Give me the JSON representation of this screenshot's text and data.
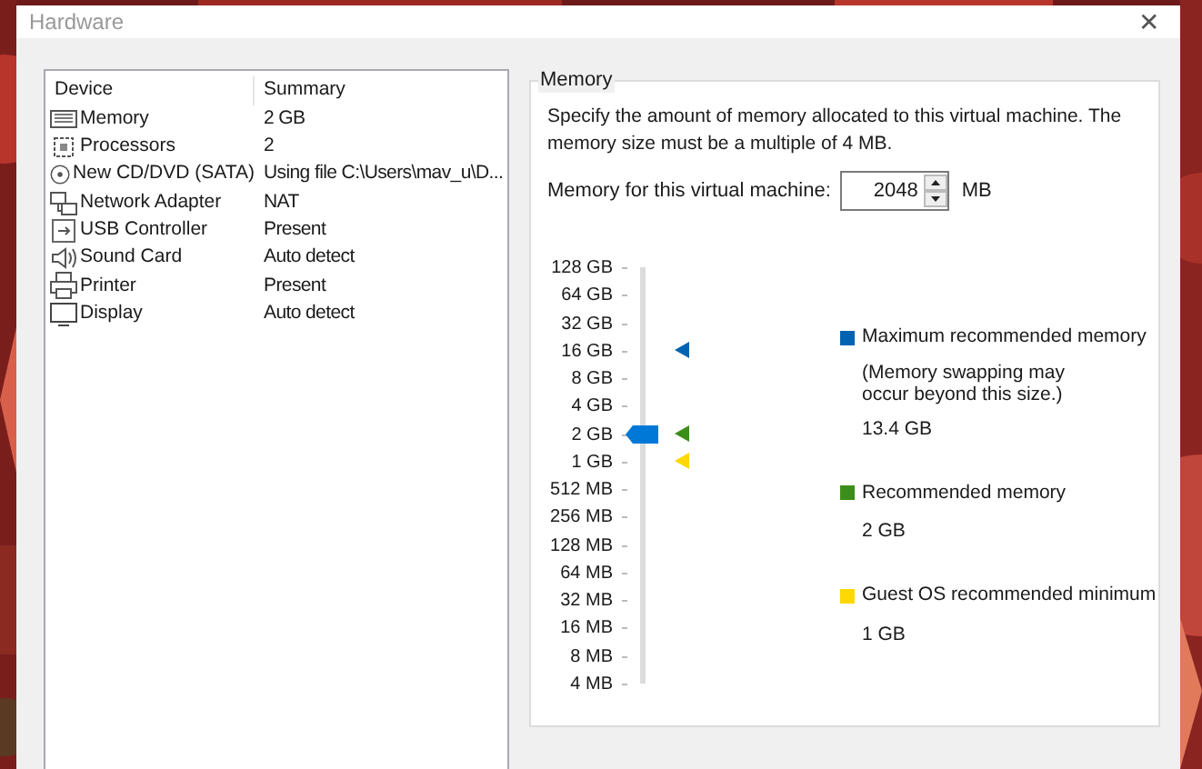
{
  "window": {
    "title": "Hardware",
    "close": "✕"
  },
  "device_list": {
    "columns": [
      "Device",
      "Summary"
    ],
    "rows": [
      {
        "kind": "memory",
        "device": "Memory",
        "summary": "2 GB",
        "selected": false
      },
      {
        "kind": "processor",
        "device": "Processors",
        "summary": "2",
        "selected": false
      },
      {
        "kind": "disc",
        "device": "New CD/DVD (SATA)",
        "summary": "Using file C:\\Users\\mav_u\\D...",
        "selected": false
      },
      {
        "kind": "network",
        "device": "Network Adapter",
        "summary": "NAT",
        "selected": false
      },
      {
        "kind": "usb",
        "device": "USB Controller",
        "summary": "Present",
        "selected": false
      },
      {
        "kind": "sound",
        "device": "Sound Card",
        "summary": "Auto detect",
        "selected": false
      },
      {
        "kind": "printer",
        "device": "Printer",
        "summary": "Present",
        "selected": false
      },
      {
        "kind": "display",
        "device": "Display",
        "summary": "Auto detect",
        "selected": false
      }
    ]
  },
  "memory": {
    "title": "Memory",
    "description": "Specify the amount of memory allocated to this virtual machine. The memory size must be a multiple of 4 MB.",
    "field_label": "Memory for this virtual machine:",
    "value": "2048",
    "unit": "MB",
    "scale": [
      "128 GB",
      "64 GB",
      "32 GB",
      "16 GB",
      "8 GB",
      "4 GB",
      "2 GB",
      "1 GB",
      "512 MB",
      "256 MB",
      "128 MB",
      "64 MB",
      "32 MB",
      "16 MB",
      "8 MB",
      "4 MB"
    ],
    "slider": {
      "level": 0.6,
      "markers": [
        {
          "color": "#0063b1",
          "level": 0.8
        },
        {
          "color": "#3c8e1a",
          "level": 0.6
        },
        {
          "color": "#fcd800",
          "level": 0.5333
        }
      ]
    },
    "legend": [
      {
        "label": "Maximum recommended memory",
        "note": "(Memory swapping may occur beyond this size.)",
        "value": "13.4 GB",
        "color": "#0063b1"
      },
      {
        "label": "Recommended memory",
        "value": "2 GB",
        "color": "#3c8e1a"
      },
      {
        "label": "Guest OS recommended minimum",
        "value": "1 GB",
        "color": "#fcd800"
      }
    ]
  }
}
